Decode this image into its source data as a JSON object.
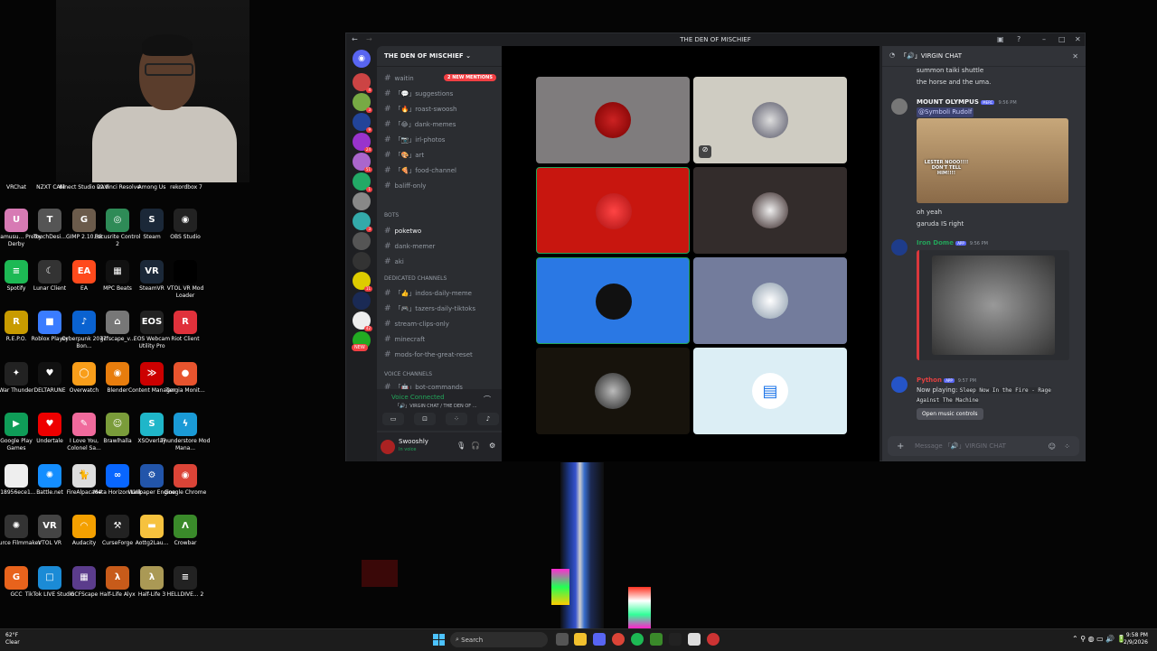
{
  "desktop": {
    "top_row_labels": [
      "VRChat",
      "NZXT CAM",
      "Kinect Studio v2.0",
      "DaVinci Resolve",
      "Among Us",
      "rekordbox 7"
    ],
    "icons": [
      {
        "label": "Umamusu... Pretty Derby",
        "color": "#d77ab4",
        "glyph": "U"
      },
      {
        "label": "TouchDesi...",
        "color": "#555",
        "glyph": "T"
      },
      {
        "label": "GIMP 2.10.38",
        "color": "#6b5b4b",
        "glyph": "G"
      },
      {
        "label": "Focusrite Control 2",
        "color": "#2e8b57",
        "glyph": "◎"
      },
      {
        "label": "Steam",
        "color": "#1b2838",
        "glyph": "S"
      },
      {
        "label": "OBS Studio",
        "color": "#222",
        "glyph": "◉"
      },
      {
        "label": "Spotify",
        "color": "#1db954",
        "glyph": "≡"
      },
      {
        "label": "Lunar Client",
        "color": "#333",
        "glyph": "☾"
      },
      {
        "label": "EA",
        "color": "#ff4a1c",
        "glyph": "EA"
      },
      {
        "label": "MPC Beats",
        "color": "#111",
        "glyph": "▦"
      },
      {
        "label": "SteamVR",
        "color": "#1b2838",
        "glyph": "VR"
      },
      {
        "label": "VTOL VR Mod Loader",
        "color": "#000",
        "glyph": ""
      },
      {
        "label": "R.E.P.O.",
        "color": "#c89b00",
        "glyph": "R"
      },
      {
        "label": "Roblox Player",
        "color": "#3a7cff",
        "glyph": "■"
      },
      {
        "label": "Cyberpunk 2077 Bon...",
        "color": "#0a62d0",
        "glyph": "♪"
      },
      {
        "label": "gcfscape_v...",
        "color": "#777",
        "glyph": "⌂"
      },
      {
        "label": "EOS Webcam Utility Pro",
        "color": "#222",
        "glyph": "EOS"
      },
      {
        "label": "Riot Client",
        "color": "#e0313b",
        "glyph": "R"
      },
      {
        "label": "War Thunder",
        "color": "#222",
        "glyph": "✦"
      },
      {
        "label": "DELTARUNE",
        "color": "#111",
        "glyph": "♥"
      },
      {
        "label": "Overwatch",
        "color": "#f99e1a",
        "glyph": "◯"
      },
      {
        "label": "Blender",
        "color": "#e87d0d",
        "glyph": "◉"
      },
      {
        "label": "Content Manager",
        "color": "#c00",
        "glyph": "≫"
      },
      {
        "label": "Tangia Monit...",
        "color": "#e8542e",
        "glyph": "●"
      },
      {
        "label": "Google Play Games",
        "color": "#0f9d58",
        "glyph": "▶"
      },
      {
        "label": "Undertale",
        "color": "#e00",
        "glyph": "♥"
      },
      {
        "label": "I Love You, Colonel Sa...",
        "color": "#f06a9c",
        "glyph": "✎"
      },
      {
        "label": "Brawlhalla",
        "color": "#7a9c3a",
        "glyph": "☺"
      },
      {
        "label": "XSOverlay",
        "color": "#1fb6c9",
        "glyph": "S"
      },
      {
        "label": "Thunderstore Mod Mana...",
        "color": "#1a9ad6",
        "glyph": "ϟ"
      },
      {
        "label": "e18956ece1...",
        "color": "#eee",
        "glyph": ""
      },
      {
        "label": "Battle.net",
        "color": "#148eff",
        "glyph": "✺"
      },
      {
        "label": "FireAlpaca64",
        "color": "#ddd",
        "glyph": "🐈"
      },
      {
        "label": "Meta Horizon Link",
        "color": "#0866ff",
        "glyph": "∞"
      },
      {
        "label": "Wallpaper Engine",
        "color": "#2255aa",
        "glyph": "⚙"
      },
      {
        "label": "Google Chrome",
        "color": "#db4437",
        "glyph": "◉"
      },
      {
        "label": "Source Filmmaker",
        "color": "#333",
        "glyph": "✺"
      },
      {
        "label": "VTOL VR",
        "color": "#444",
        "glyph": "VR"
      },
      {
        "label": "Audacity",
        "color": "#f4a000",
        "glyph": "◠"
      },
      {
        "label": "CurseForge",
        "color": "#222",
        "glyph": "⚒"
      },
      {
        "label": "Aottg2Lau...",
        "color": "#f6c23e",
        "glyph": "▬"
      },
      {
        "label": "Crowbar",
        "color": "#3a8a2a",
        "glyph": "Λ"
      },
      {
        "label": "GCC",
        "color": "#e8631c",
        "glyph": "G"
      },
      {
        "label": "TikTok LIVE Studio",
        "color": "#1b8bd6",
        "glyph": "□"
      },
      {
        "label": "GCFScape",
        "color": "#5b3c8c",
        "glyph": "▦"
      },
      {
        "label": "Half-Life Alyx",
        "color": "#c75b1a",
        "glyph": "λ"
      },
      {
        "label": "Half-Life 3",
        "color": "#aa9955",
        "glyph": "λ"
      },
      {
        "label": "HELLDIVE... 2",
        "color": "#222",
        "glyph": "≡"
      }
    ]
  },
  "taskbar": {
    "temp": "62°F",
    "weather": "Clear",
    "search_placeholder": "Search",
    "time": "9:58 PM",
    "date": "2/9/2026"
  },
  "discord": {
    "window_title": "THE DEN OF MISCHIEF",
    "server_name": "THE DEN OF MISCHIEF",
    "mentions_pill": "2 NEW MENTIONS",
    "channels": [
      {
        "name": "waitin",
        "kind": "text"
      },
      {
        "name": "「💬」suggestions",
        "kind": "text"
      },
      {
        "name": "「🔥」roast-swoosh",
        "kind": "text"
      },
      {
        "name": "「😂」dank-memes",
        "kind": "text"
      },
      {
        "name": "「📷」irl-photos",
        "kind": "text"
      },
      {
        "name": "「🎨」art",
        "kind": "text"
      },
      {
        "name": "「🍕」food-channel",
        "kind": "text"
      },
      {
        "name": "baliff-only",
        "kind": "text"
      }
    ],
    "bots_category": "Bots",
    "bot_channels": [
      "poketwo",
      "dank-memer",
      "aki"
    ],
    "dedicated_category": "DEDICATED CHANNELS",
    "dedicated_channels": [
      "「👍」indos-daily-meme",
      "「🎮」tazers-daily-tiktoks",
      "stream-clips-only",
      "minecraft",
      "mods-for-the-great-reset"
    ],
    "voice_category": "Voice Channels",
    "voice_channels": [
      "「🤖」bot-commands"
    ],
    "new_label": "NEW",
    "voice_status": "Voice Connected",
    "voice_location": "「🔊」VIRGIN CHAT / THE DEN OF ...",
    "username": "Swooshly",
    "user_status": "In voice",
    "chat_channel": "「🔊」VIRGIN CHAT",
    "chat_placeholder": "Message 「🔊」VIRGIN CHAT",
    "messages": [
      {
        "text1": "summon taiki shuttle",
        "text2": "the horse and the uma."
      },
      {
        "author": "MOUNT OLYMPUS",
        "tag": "MERC",
        "time": "9:56 PM",
        "mention": "@Symboli Rudolf",
        "meme_text": "LESTER NOOO!!!! DON'T TELL HIM!!!!",
        "after1": "oh yeah",
        "after2": "garuda IS right"
      },
      {
        "author": "Iron Dome",
        "tag": "APP",
        "time": "9:56 PM"
      },
      {
        "author": "Python",
        "tag": "APP",
        "time": "9:57 PM",
        "now_playing": "Now playing:",
        "song": "Sleep Now In the Fire - Rage Against The Machine",
        "button": "Open music controls"
      }
    ]
  }
}
